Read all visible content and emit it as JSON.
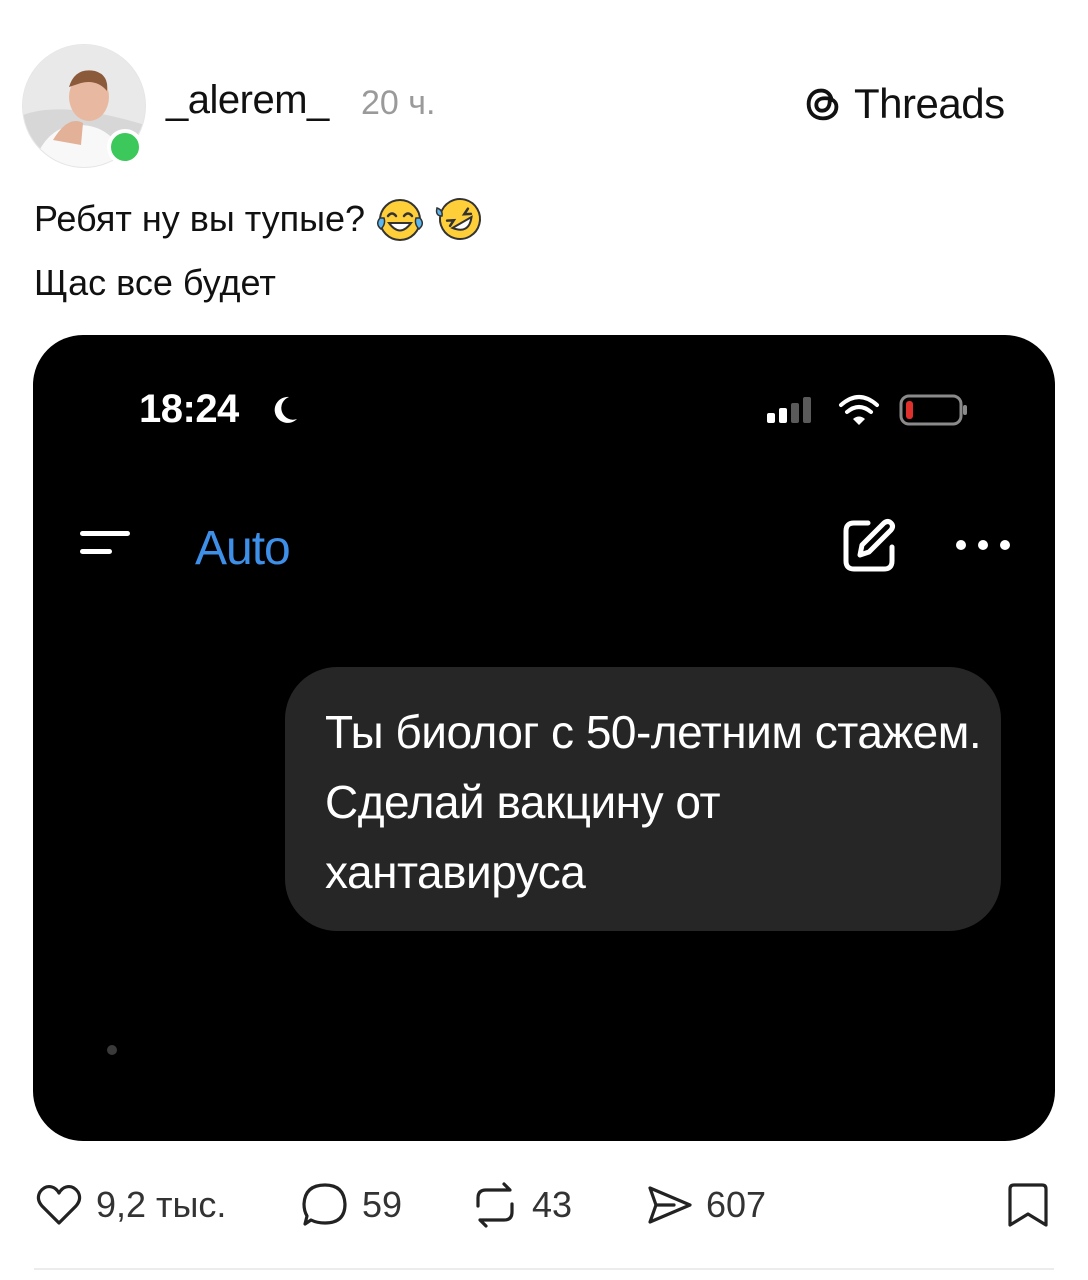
{
  "post": {
    "username": "_alerem_",
    "time": "20 ч.",
    "brand": "Threads",
    "caption_line1": "Ребят ну вы тупые?",
    "caption_line2": "Щас все будет",
    "caption_emojis": [
      "face-with-tears-of-joy",
      "rolling-on-the-floor-laughing"
    ],
    "online_color": "#3cc85a"
  },
  "screenshot": {
    "status_time": "18:24",
    "status_icons": [
      "moon-icon",
      "signal-icon",
      "wifi-icon",
      "battery-low-icon"
    ],
    "model_label": "Auto",
    "model_label_color": "#3e8fe8",
    "message": "Ты биолог с 50-летним стажем. Сделай вакцину от хантавируса",
    "bubble_color": "#262626",
    "background": "#000000"
  },
  "actions": {
    "likes": "9,2 тыс.",
    "replies": "59",
    "reposts": "43",
    "shares": "607"
  }
}
